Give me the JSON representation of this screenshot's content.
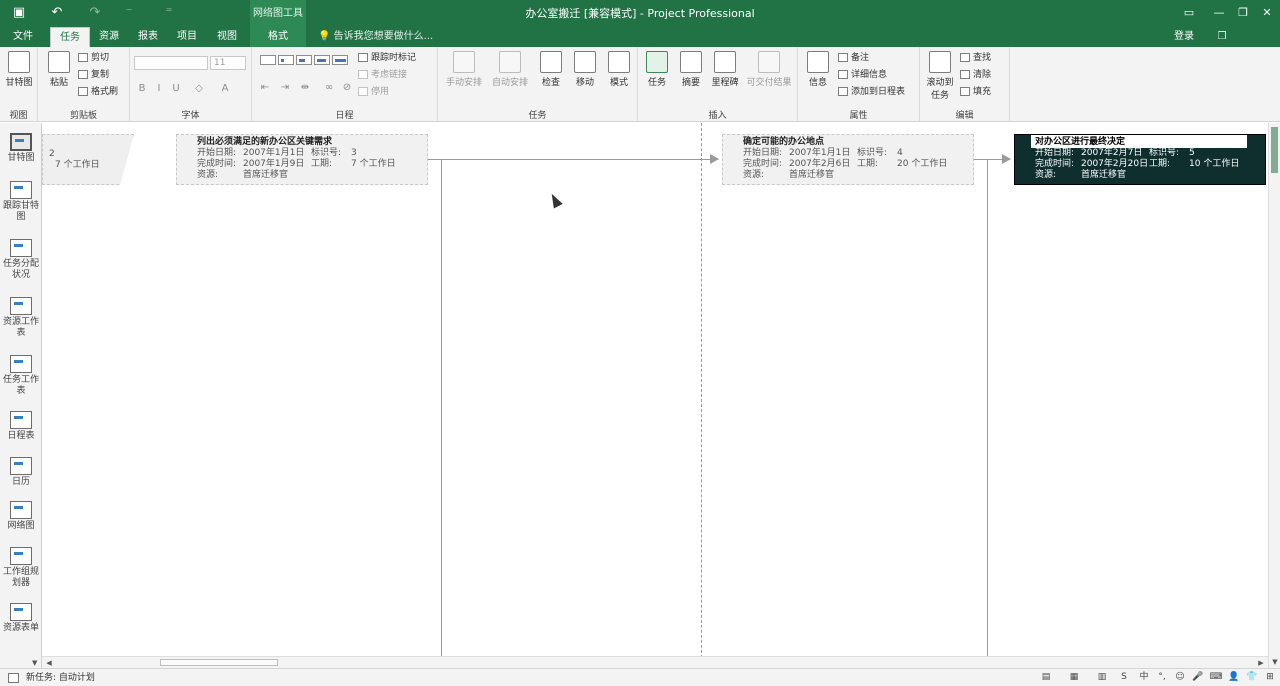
{
  "titlebar": {
    "title": "办公室搬迁 [兼容模式] - Project Professional",
    "tool_context": "网络图工具",
    "qat": {
      "save_icon": "save-icon",
      "undo_icon": "undo-icon",
      "redo_icon": "redo-icon",
      "qat_more_icon": "customize-qat-icon"
    },
    "window_controls": {
      "minimize": "—",
      "restore": "❐",
      "close": "✕"
    }
  },
  "tabs": [
    {
      "label": "文件"
    },
    {
      "label": "任务"
    },
    {
      "label": "资源"
    },
    {
      "label": "报表"
    },
    {
      "label": "项目"
    },
    {
      "label": "视图"
    },
    {
      "label": "格式"
    }
  ],
  "active_tab": "任务",
  "tell_me": "告诉我您想要做什么...",
  "signin": "登录",
  "ribbon": {
    "groups": {
      "view": "视图",
      "clipboard": "剪贴板",
      "font": "字体",
      "schedule": "日程",
      "tasks": "任务",
      "insert": "插入",
      "properties": "属性",
      "editing": "编辑"
    },
    "view_btn": "甘特图",
    "paste": "粘贴",
    "cut": "剪切",
    "copy": "复制",
    "format_painter": "格式刷",
    "font_name": "",
    "font_size": "11",
    "bold": "B",
    "italic": "I",
    "underline": "U",
    "mark_on_track": "跟踪时标记",
    "respect_links": "考虑链接",
    "inactivate": "停用",
    "manual_schedule": "手动安排",
    "auto_schedule": "自动安排",
    "inspect": "检查",
    "move": "移动",
    "mode": "模式",
    "task": "任务",
    "summary": "摘要",
    "milestone": "里程碑",
    "deliverable": "可交付结果",
    "information": "信息",
    "notes": "备注",
    "details": "详细信息",
    "add_to_timeline": "添加到日程表",
    "scroll_to_task": "滚动到任务",
    "find": "查找",
    "clear": "清除",
    "fill": "填充"
  },
  "views": [
    {
      "label": "甘特图"
    },
    {
      "label": "跟踪甘特图"
    },
    {
      "label": "任务分配状况"
    },
    {
      "label": "资源工作表"
    },
    {
      "label": "任务工作表"
    },
    {
      "label": "日程表"
    },
    {
      "label": "日历"
    },
    {
      "label": "网络图"
    },
    {
      "label": "工作组规划器"
    },
    {
      "label": "资源表单"
    }
  ],
  "network": {
    "partial_node": {
      "id": "2",
      "duration": "7 个工作日"
    },
    "nodes": [
      {
        "title": "列出必须满足的新办公区关键需求",
        "start_label": "开始日期:",
        "start": "2007年1月1日",
        "id_label": "标识号:",
        "id": "3",
        "finish_label": "完成时间:",
        "finish": "2007年1月9日",
        "dur_label": "工期:",
        "duration": "7 个工作日",
        "res_label": "资源:",
        "resource": "首席迁移官"
      },
      {
        "title": "确定可能的办公地点",
        "start_label": "开始日期:",
        "start": "2007年1月1日",
        "id_label": "标识号:",
        "id": "4",
        "finish_label": "完成时间:",
        "finish": "2007年2月6日",
        "dur_label": "工期:",
        "duration": "20 个工作日",
        "res_label": "资源:",
        "resource": "首席迁移官"
      },
      {
        "title": "对办公区进行最终决定",
        "start_label": "开始日期:",
        "start": "2007年2月7日",
        "id_label": "标识号:",
        "id": "5",
        "finish_label": "完成时间:",
        "finish": "2007年2月20日",
        "dur_label": "工期:",
        "duration": "10 个工作日",
        "res_label": "资源:",
        "resource": "首席迁移官"
      }
    ]
  },
  "status": {
    "new_tasks": "新任务: 自动计划",
    "icons": [
      "normal-view-icon",
      "task-usage-icon",
      "team-planner-icon",
      "resource-sheet-icon"
    ],
    "ime": [
      "中",
      "°,",
      "☺",
      "🎤",
      "⌨",
      "👤",
      "👕",
      "⊞"
    ]
  }
}
